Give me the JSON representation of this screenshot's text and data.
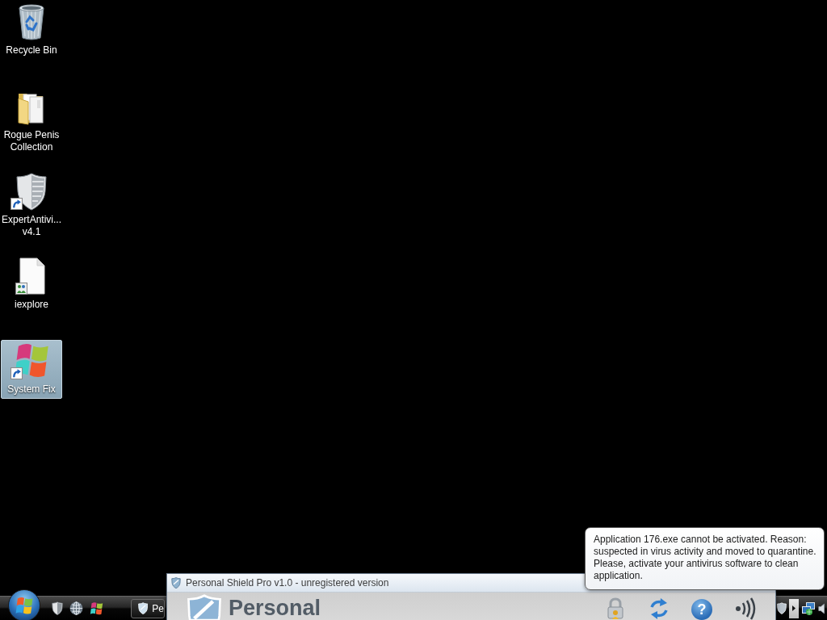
{
  "desktop_icons": [
    {
      "kind": "recycle-bin",
      "label": "Recycle Bin",
      "shortcut": false,
      "selected": false
    },
    {
      "kind": "folder",
      "label": "Rogue Penis Collection",
      "shortcut": false,
      "selected": false
    },
    {
      "kind": "shield",
      "label": "ExpertAntivi... v4.1",
      "shortcut": true,
      "selected": false
    },
    {
      "kind": "file",
      "label": "iexplore",
      "shortcut": false,
      "selected": false
    },
    {
      "kind": "flag",
      "label": "System Fix",
      "shortcut": true,
      "selected": true
    }
  ],
  "window": {
    "title": "Personal Shield Pro v1.0 - unregistered version",
    "heading": "Personal",
    "toolbar": [
      {
        "kind": "lock"
      },
      {
        "kind": "refresh"
      },
      {
        "kind": "help",
        "glyph": "?"
      },
      {
        "kind": "sound"
      }
    ]
  },
  "notification": {
    "message": "Application 176.exe cannot be activated. Reason: suspected in virus activity and moved to quarantine. Please, activate your antivirus software to clean application."
  },
  "taskbar": {
    "quick_launch": [
      {
        "kind": "shield"
      },
      {
        "kind": "globe"
      },
      {
        "kind": "flag"
      }
    ],
    "buttons": [
      {
        "label": "Pe"
      }
    ],
    "tray": [
      {
        "kind": "shield"
      },
      {
        "kind": "expand"
      },
      {
        "kind": "network"
      },
      {
        "kind": "speaker"
      }
    ]
  }
}
